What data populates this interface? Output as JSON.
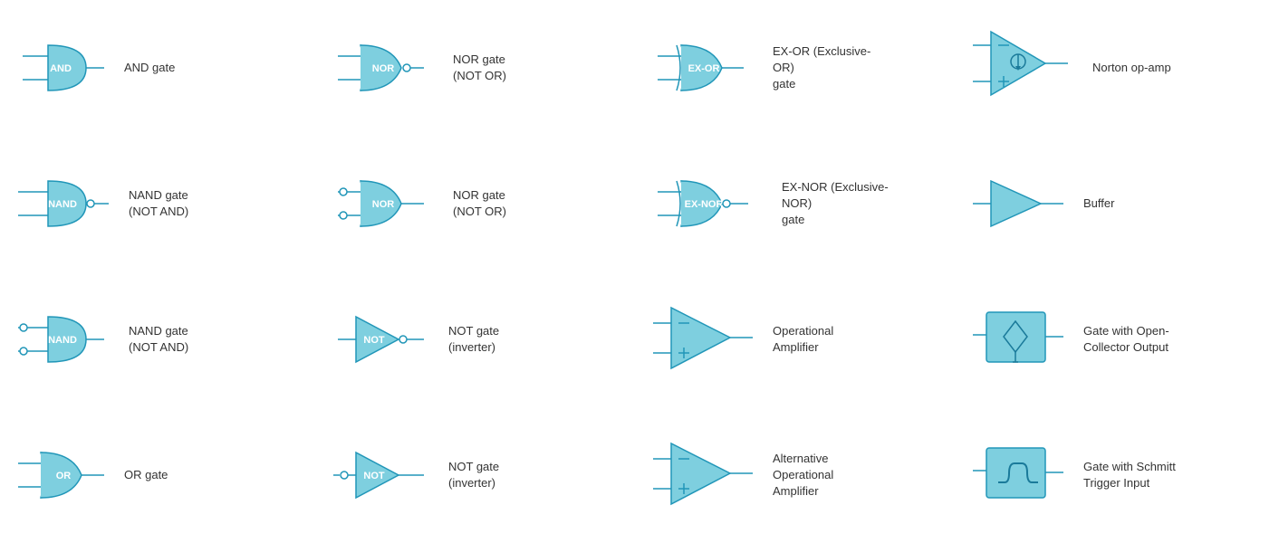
{
  "cells": [
    {
      "id": "and-gate",
      "label": "AND gate",
      "col": 1,
      "row": 1
    },
    {
      "id": "nor-gate-1",
      "label": "NOR gate\n(NOT OR)",
      "col": 2,
      "row": 1
    },
    {
      "id": "ex-or-gate",
      "label": "EX-OR (Exclusive-OR)\ngate",
      "col": 3,
      "row": 1
    },
    {
      "id": "norton-op-amp",
      "label": "Norton op-amp",
      "col": 4,
      "row": 1
    },
    {
      "id": "nand-gate-1",
      "label": "NAND gate\n(NOT AND)",
      "col": 1,
      "row": 2
    },
    {
      "id": "nor-gate-2",
      "label": "NOR gate\n(NOT OR)",
      "col": 2,
      "row": 2
    },
    {
      "id": "ex-nor-gate",
      "label": "EX-NOR (Exclusive-NOR)\ngate",
      "col": 3,
      "row": 2
    },
    {
      "id": "buffer",
      "label": "Buffer",
      "col": 4,
      "row": 2
    },
    {
      "id": "nand-gate-2",
      "label": "NAND gate\n(NOT AND)",
      "col": 1,
      "row": 3
    },
    {
      "id": "not-gate-1",
      "label": "NOT gate\n(inverter)",
      "col": 2,
      "row": 3
    },
    {
      "id": "op-amp",
      "label": "Operational Amplifier",
      "col": 3,
      "row": 3
    },
    {
      "id": "gate-open-collector",
      "label": "Gate with Open-Collector Output",
      "col": 4,
      "row": 3
    },
    {
      "id": "or-gate",
      "label": "OR gate",
      "col": 1,
      "row": 4
    },
    {
      "id": "not-gate-2",
      "label": "NOT gate\n(inverter)",
      "col": 2,
      "row": 4
    },
    {
      "id": "alt-op-amp",
      "label": "Alternative\nOperational Amplifier",
      "col": 3,
      "row": 4
    },
    {
      "id": "schmitt-trigger",
      "label": "Gate with Schmitt\nTrigger Input",
      "col": 4,
      "row": 4
    }
  ]
}
